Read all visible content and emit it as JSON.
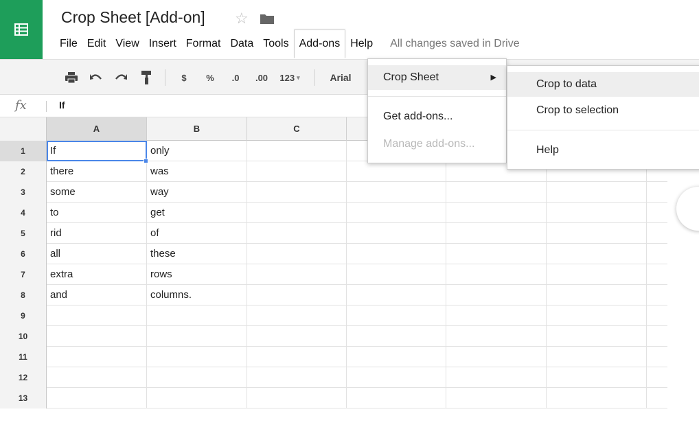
{
  "app": {
    "title": "Crop Sheet [Add-on]",
    "brand_color": "#1e9e5a",
    "accent_color": "#4a86e8"
  },
  "menubar": {
    "items": [
      "File",
      "Edit",
      "View",
      "Insert",
      "Format",
      "Data",
      "Tools",
      "Add-ons",
      "Help"
    ],
    "open_item": "Add-ons",
    "save_status": "All changes saved in Drive"
  },
  "toolbar": {
    "currency_label": "$",
    "percent_label": "%",
    "decrease_decimals_label": ".0",
    "increase_decimals_label": ".00",
    "number_format_label": "123",
    "font_label": "Arial",
    "icons": [
      "print-icon",
      "undo-icon",
      "redo-icon",
      "paint-format-icon"
    ]
  },
  "formula_bar": {
    "fx_label": "fx",
    "value": "If"
  },
  "sheet": {
    "columns": [
      "A",
      "B",
      "C",
      "",
      "",
      "",
      ""
    ],
    "active_column": "A",
    "rows": [
      {
        "num": "1",
        "a": "If",
        "b": "only"
      },
      {
        "num": "2",
        "a": "there",
        "b": "was"
      },
      {
        "num": "3",
        "a": "some",
        "b": "way"
      },
      {
        "num": "4",
        "a": "to",
        "b": "get"
      },
      {
        "num": "5",
        "a": "rid",
        "b": "of"
      },
      {
        "num": "6",
        "a": "all",
        "b": "these"
      },
      {
        "num": "7",
        "a": "extra",
        "b": "rows"
      },
      {
        "num": "8",
        "a": "and",
        "b": "columns."
      },
      {
        "num": "9",
        "a": "",
        "b": ""
      },
      {
        "num": "10",
        "a": "",
        "b": ""
      },
      {
        "num": "11",
        "a": "",
        "b": ""
      },
      {
        "num": "12",
        "a": "",
        "b": ""
      },
      {
        "num": "13",
        "a": "",
        "b": ""
      }
    ],
    "selected_cell": "A1"
  },
  "addons_menu": {
    "items": [
      {
        "label": "Crop Sheet",
        "has_submenu": true,
        "state": "hover"
      },
      {
        "label": "Get add-ons...",
        "state": "normal"
      },
      {
        "label": "Manage add-ons...",
        "state": "disabled"
      }
    ]
  },
  "crop_submenu": {
    "items": [
      {
        "label": "Crop to data",
        "state": "hover"
      },
      {
        "label": "Crop to selection",
        "state": "normal"
      },
      {
        "label": "Help",
        "state": "normal"
      }
    ]
  }
}
